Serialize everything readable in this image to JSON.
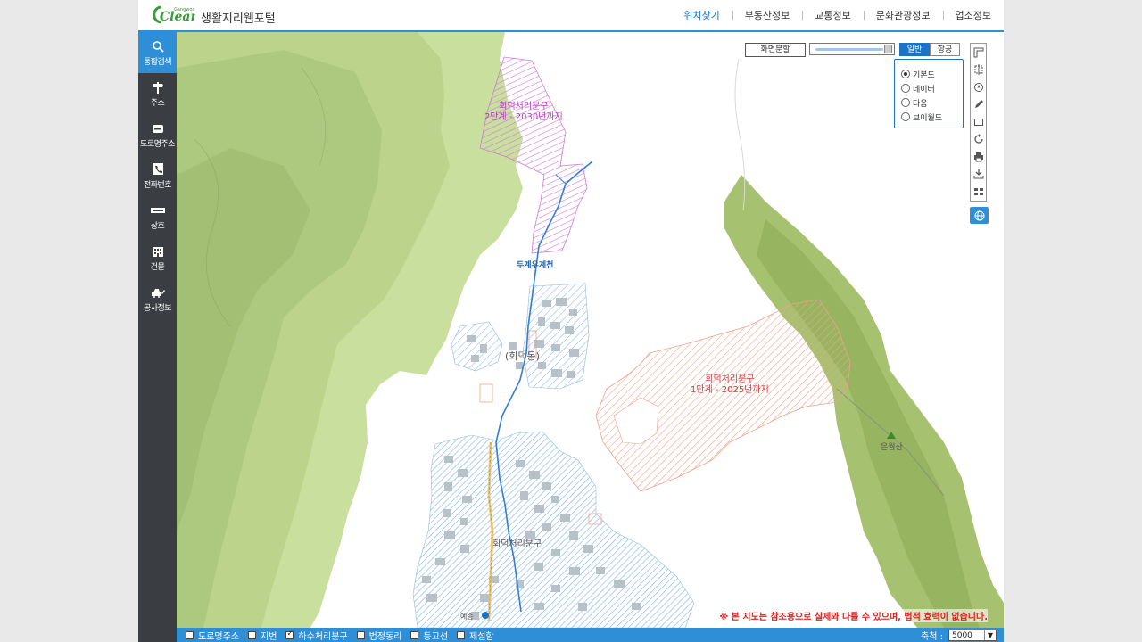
{
  "header": {
    "logo_text": "Clean",
    "logo_subtext": "Gangwon",
    "portal_title": "생활지리웹포털",
    "nav": [
      {
        "label": "위치찾기",
        "active": true
      },
      {
        "label": "부동산정보",
        "active": false
      },
      {
        "label": "교통정보",
        "active": false
      },
      {
        "label": "문화관광정보",
        "active": false
      },
      {
        "label": "업소정보",
        "active": false
      }
    ]
  },
  "sidebar": {
    "items": [
      {
        "label": "통합검색",
        "icon": "search-icon",
        "active": true
      },
      {
        "label": "주소",
        "icon": "signpost-icon",
        "active": false
      },
      {
        "label": "도로명주소",
        "icon": "road-address-icon",
        "active": false
      },
      {
        "label": "전화번호",
        "icon": "phone-icon",
        "active": false
      },
      {
        "label": "상호",
        "icon": "store-sign-icon",
        "active": false
      },
      {
        "label": "건물",
        "icon": "building-icon",
        "active": false
      },
      {
        "label": "공사정보",
        "icon": "construction-icon",
        "active": false
      }
    ],
    "collapse_arrow": "›"
  },
  "map": {
    "labels": {
      "zone2": [
        "회덕처리분구",
        "2단계 - 2030년까지"
      ],
      "zone1": [
        "회덕처리분구",
        "1단계 - 2025년까지"
      ],
      "stream": "두계우계천",
      "village": "(회덕동)",
      "zone_main": "회덕처리분구",
      "peak": "은월산",
      "stop": "예종"
    },
    "colors": {
      "mountain": "#c9df9e",
      "mountain_dark": "#a7c57a",
      "forest": "#a6c16f",
      "purple_hatch": "#d07ad8",
      "red_hatch": "#f0a28b",
      "blue_hatch": "#8bb9e6",
      "stream": "#2f7ed8"
    }
  },
  "controls": {
    "split_label": "화면분할",
    "map_types": [
      {
        "label": "일반",
        "active": true
      },
      {
        "label": "항공",
        "active": false
      }
    ],
    "basemap_options": [
      {
        "label": "기본도",
        "selected": true
      },
      {
        "label": "네이버",
        "selected": false
      },
      {
        "label": "다음",
        "selected": false
      },
      {
        "label": "브이월드",
        "selected": false
      }
    ],
    "zoom_level": 0.95,
    "tools": [
      "distance-icon",
      "area-icon",
      "location-icon",
      "pen-icon",
      "rectangle-icon",
      "refresh-icon",
      "print-icon",
      "download-icon",
      "list-icon"
    ],
    "disclaimer": "※ 본 지도는 참조용으로 실제와 다를 수 있으며, 법적 효력이 없습니다."
  },
  "bottombar": {
    "layers": [
      {
        "label": "도로명주소",
        "checked": false
      },
      {
        "label": "지번",
        "checked": false
      },
      {
        "label": "하수처리분구",
        "checked": true
      },
      {
        "label": "법정동리",
        "checked": false
      },
      {
        "label": "등고선",
        "checked": false
      },
      {
        "label": "제설함",
        "checked": false
      }
    ],
    "scale_label": "축척 :",
    "scale_value": "5000"
  }
}
